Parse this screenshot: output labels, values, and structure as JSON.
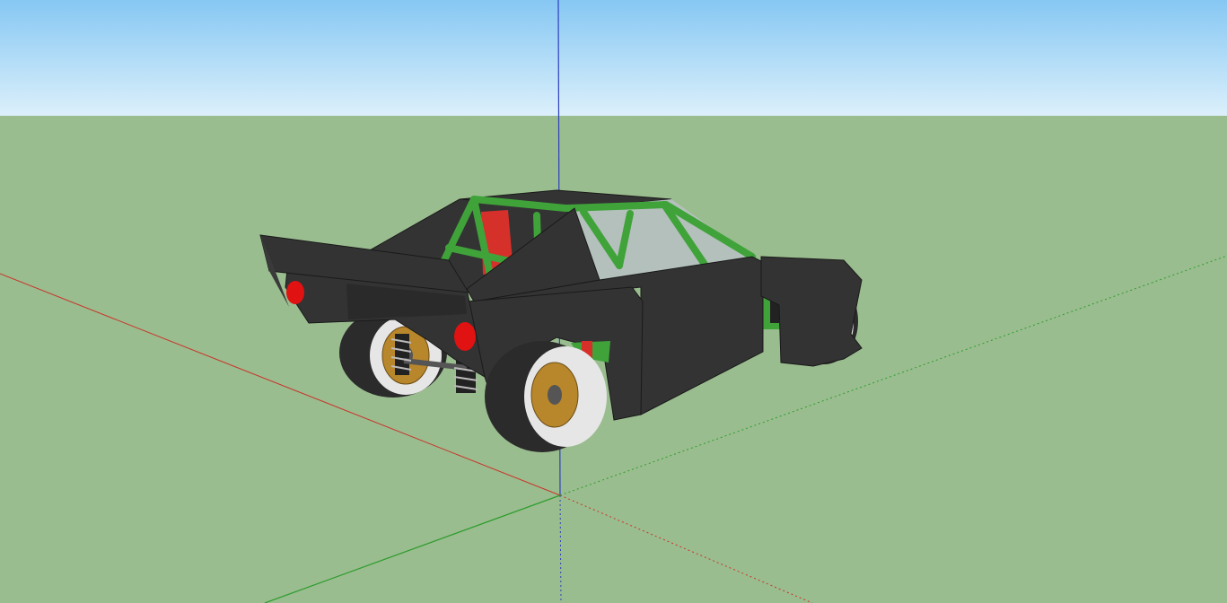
{
  "viewport": {
    "sky_top_color": "#86c7f3",
    "sky_horizon_color": "#dcf0fb",
    "ground_color": "#9abd8f"
  },
  "axes": {
    "red_axis_color": "#c8352b",
    "green_axis_color": "#2e9c2e",
    "blue_axis_color": "#2d3fbf"
  },
  "model": {
    "body_color": "#333333",
    "roll_cage_color": "#3fa33a",
    "seat_color": "#d6302a",
    "tail_light_color": "#e01212",
    "wheel_rim_color": "#b8862b",
    "tire_color": "#2b2b2b",
    "wheel_barrel_color": "#e6e6e6"
  }
}
